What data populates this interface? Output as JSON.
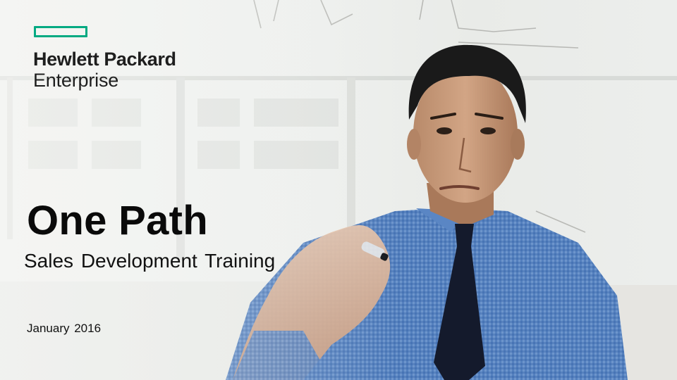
{
  "brand": {
    "name_line1": "Hewlett Packard",
    "name_line2": "Enterprise",
    "accent_color": "#01a982"
  },
  "slide": {
    "title": "One Path",
    "subtitle": "Sales Development Training",
    "date": "January 2016"
  },
  "colors": {
    "background": "#f0f1ef",
    "shirt": "#4f7fc0",
    "tie": "#141a2c",
    "text": "#111111"
  }
}
